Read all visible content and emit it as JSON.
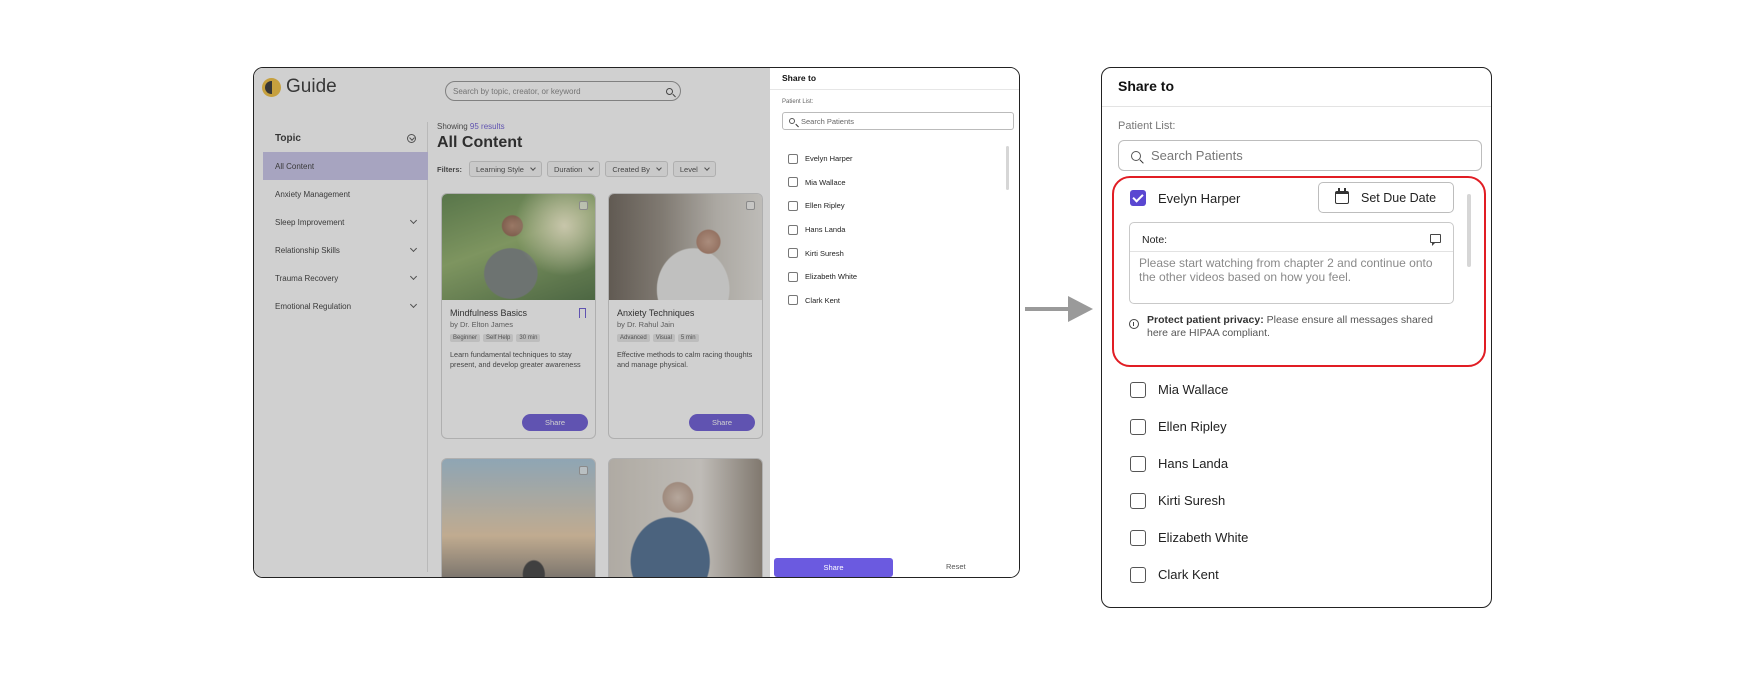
{
  "app": {
    "brand": "Guide",
    "search_placeholder": "Search by topic, creator, or keyword"
  },
  "sidebar": {
    "heading": "Topic",
    "items": [
      {
        "label": "All Content",
        "active": true
      },
      {
        "label": "Anxiety Management"
      },
      {
        "label": "Sleep Improvement"
      },
      {
        "label": "Relationship Skills"
      },
      {
        "label": "Trauma Recovery"
      },
      {
        "label": "Emotional Regulation"
      }
    ]
  },
  "main": {
    "showing_prefix": "Showing",
    "results_count": "95 results",
    "title": "All Content",
    "filters_label": "Filters:",
    "filters": [
      "Learning Style",
      "Duration",
      "Created By",
      "Level"
    ]
  },
  "cards": [
    {
      "title": "Mindfulness Basics",
      "author": "by Dr. Elton James",
      "tags": [
        "Beginner",
        "Self Help",
        "30 min"
      ],
      "description": "Learn fundamental techniques to stay present, and develop greater awareness",
      "share_label": "Share"
    },
    {
      "title": "Anxiety Techniques",
      "author": "by Dr. Rahul Jain",
      "tags": [
        "Advanced",
        "Visual",
        "5 min"
      ],
      "description": "Effective methods to calm racing thoughts and manage physical.",
      "share_label": "Share"
    }
  ],
  "share_panel": {
    "title": "Share to",
    "list_label": "Patient List:",
    "search_placeholder": "Search Patients",
    "patients": [
      "Evelyn Harper",
      "Mia Wallace",
      "Ellen Ripley",
      "Hans Landa",
      "Kirti Suresh",
      "Elizabeth White",
      "Clark Kent"
    ],
    "share_button": "Share",
    "reset_button": "Reset"
  },
  "zoom_panel": {
    "title": "Share to",
    "list_label": "Patient List:",
    "search_placeholder": "Search Patients",
    "selected_patient": "Evelyn Harper",
    "due_date_button": "Set Due Date",
    "note_label": "Note:",
    "note_text": "Please start watching from chapter 2 and continue onto the other videos based on how you feel.",
    "privacy_bold": "Protect patient privacy:",
    "privacy_text": "Please ensure all messages shared here are HIPAA compliant.",
    "other_patients": [
      "Mia Wallace",
      "Ellen Ripley",
      "Hans Landa",
      "Kirti Suresh",
      "Elizabeth White",
      "Clark Kent"
    ]
  },
  "colors": {
    "accent": "#5a47d1",
    "highlight": "#e11d24",
    "active_nav": "#c3bee8"
  }
}
